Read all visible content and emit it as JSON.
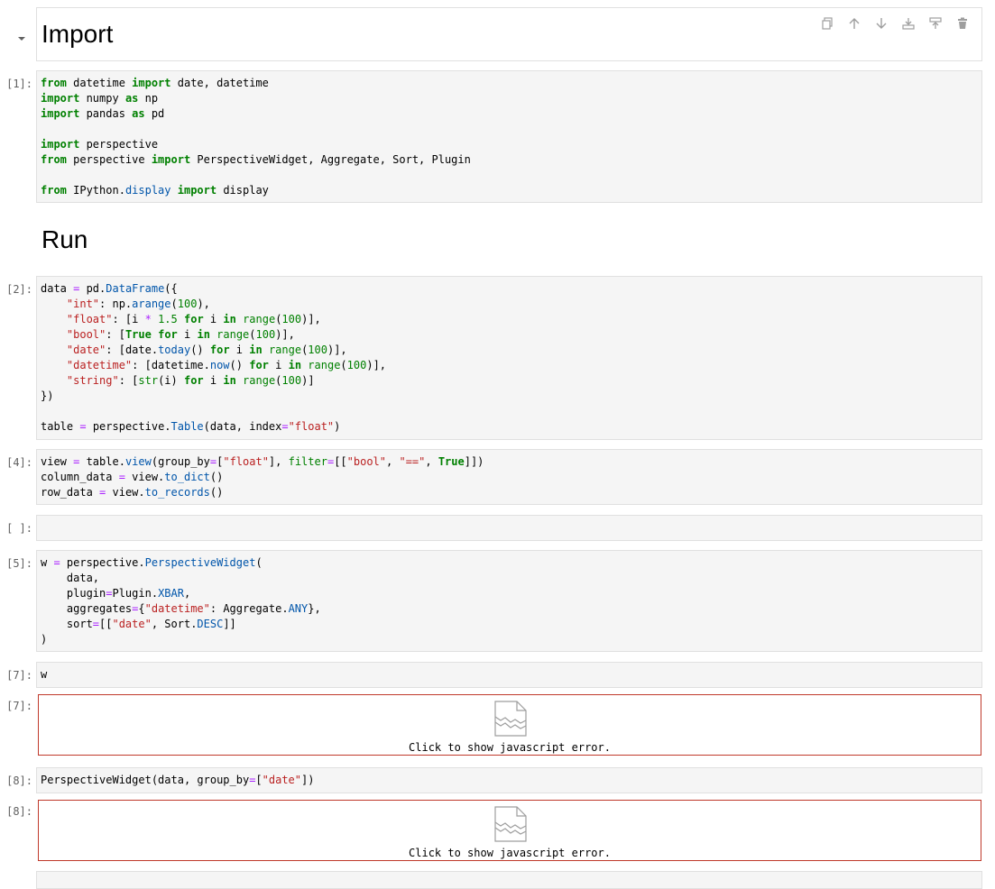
{
  "notebook": {
    "heading_import": "Import",
    "heading_run": "Run",
    "toolbar": {
      "icons": [
        "copy-icon",
        "move-up-icon",
        "move-down-icon",
        "insert-above-icon",
        "insert-below-icon",
        "delete-icon"
      ]
    },
    "cells": [
      {
        "prompt": "[1]:"
      },
      {
        "prompt": "[2]:"
      },
      {
        "prompt": "[4]:"
      },
      {
        "prompt": "[ ]:"
      },
      {
        "prompt": "[5]:"
      },
      {
        "prompt": "[7]:"
      },
      {
        "prompt": "[8]:"
      }
    ],
    "outputs": [
      {
        "prompt": "[7]:",
        "error_text": "Click to show javascript error."
      },
      {
        "prompt": "[8]:",
        "error_text": "Click to show javascript error."
      }
    ]
  },
  "code": {
    "c1": {
      "l1": [
        "from",
        " datetime ",
        "import",
        " date, datetime"
      ],
      "l2": [
        "import",
        " numpy ",
        "as",
        " np"
      ],
      "l3": [
        "import",
        " pandas ",
        "as",
        " pd"
      ],
      "l5": [
        "import",
        " perspective"
      ],
      "l6": [
        "from",
        " perspective ",
        "import",
        " PerspectiveWidget, Aggregate, Sort, Plugin"
      ],
      "l8": [
        "from",
        " IPython.",
        "display",
        " ",
        "import",
        " display"
      ]
    },
    "c2": {
      "l1": [
        "data ",
        "=",
        " pd.",
        "DataFrame",
        "({"
      ],
      "l2": [
        "    ",
        "\"int\"",
        ": np.",
        "arange",
        "(",
        "100",
        "),"
      ],
      "l3": [
        "    ",
        "\"float\"",
        ": [i ",
        "*",
        " ",
        "1.5",
        " ",
        "for",
        " i ",
        "in",
        " ",
        "range",
        "(",
        "100",
        ")],"
      ],
      "l4": [
        "    ",
        "\"bool\"",
        ": [",
        "True",
        " ",
        "for",
        " i ",
        "in",
        " ",
        "range",
        "(",
        "100",
        ")],"
      ],
      "l5": [
        "    ",
        "\"date\"",
        ": [date.",
        "today",
        "() ",
        "for",
        " i ",
        "in",
        " ",
        "range",
        "(",
        "100",
        ")],"
      ],
      "l6": [
        "    ",
        "\"datetime\"",
        ": [datetime.",
        "now",
        "() ",
        "for",
        " i ",
        "in",
        " ",
        "range",
        "(",
        "100",
        ")],"
      ],
      "l7": [
        "    ",
        "\"string\"",
        ": [",
        "str",
        "(i) ",
        "for",
        " i ",
        "in",
        " ",
        "range",
        "(",
        "100",
        ")]"
      ],
      "l8": [
        "})"
      ],
      "l10": [
        "table ",
        "=",
        " perspective.",
        "Table",
        "(data, index",
        "=",
        "\"float\"",
        ")"
      ]
    },
    "c3": {
      "l1": [
        "view ",
        "=",
        " table.",
        "view",
        "(group_by",
        "=",
        "[",
        "\"float\"",
        "], ",
        "filter",
        "=",
        "[[",
        "\"bool\"",
        ", ",
        "\"==\"",
        ", ",
        "True",
        "]])"
      ],
      "l2": [
        "column_data ",
        "=",
        " view.",
        "to_dict",
        "()"
      ],
      "l3": [
        "row_data ",
        "=",
        " view.",
        "to_records",
        "()"
      ]
    },
    "c5": {
      "l1": [
        "w ",
        "=",
        " perspective.",
        "PerspectiveWidget",
        "("
      ],
      "l2": [
        "    data,"
      ],
      "l3": [
        "    plugin",
        "=",
        "Plugin.",
        "XBAR",
        ","
      ],
      "l4": [
        "    aggregates",
        "=",
        "{",
        "\"datetime\"",
        ": Aggregate.",
        "ANY",
        "},"
      ],
      "l5": [
        "    sort",
        "=",
        "[[",
        "\"date\"",
        ", Sort.",
        "DESC",
        "]]"
      ],
      "l6": [
        ")"
      ]
    },
    "c6": {
      "l1": [
        "w"
      ]
    },
    "c7": {
      "l1": [
        "PerspectiveWidget(data, group_by",
        "=",
        "[",
        "\"date\"",
        "])"
      ]
    }
  }
}
